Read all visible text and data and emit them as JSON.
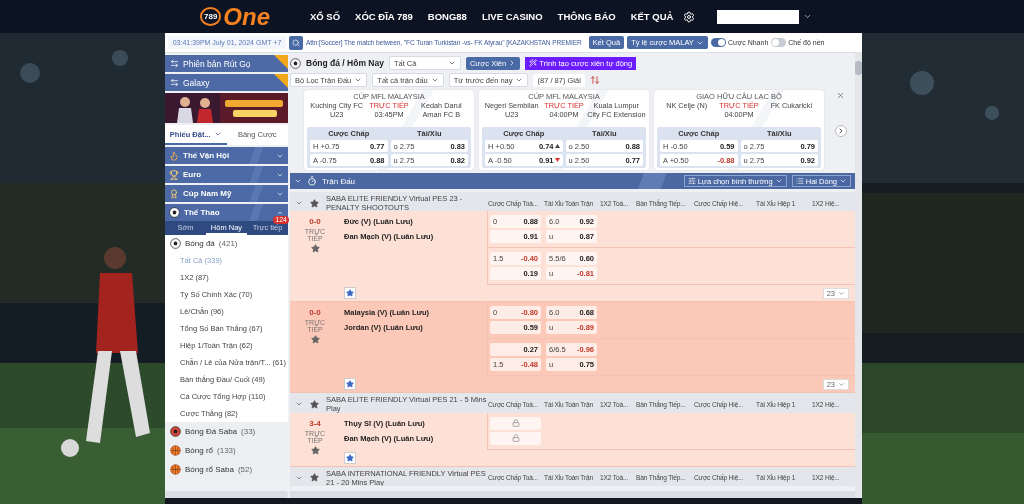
{
  "header": {
    "logo_number": "789",
    "logo_word": "One",
    "nav": [
      "XỔ SỐ",
      "XÓC ĐĨA 789",
      "BONG88",
      "LIVE CASINO",
      "THÔNG BÁO",
      "KẾT QUẢ"
    ]
  },
  "topbar": {
    "clock": "03:41:39PM July 01, 2024 GMT +7",
    "announcement": "Attn:[Soccer] The match between, \"FC Turan Turkistan -vs- FK Atyrau\" [KAZAKHSTAN PREMIER",
    "results_button": "Kết Quả",
    "odds_type": "Tỷ lệ cược MALAY",
    "toggles": [
      {
        "label": "Cược Nhanh",
        "on": true
      },
      {
        "label": "Chế độ nền",
        "on": false
      }
    ]
  },
  "sidebar": {
    "shortcuts": [
      {
        "label": "Phiên bản Rút Gọ",
        "new": true
      },
      {
        "label": "Galaxy",
        "new": true
      }
    ],
    "tabs": [
      {
        "label": "Phiếu Đặt...",
        "selected": true
      },
      {
        "label": "Bảng Cược",
        "selected": false
      }
    ],
    "sections": [
      {
        "label": "Thế Vận Hội",
        "kind": "torch",
        "expanded": false
      },
      {
        "label": "Euro",
        "kind": "trophy",
        "expanded": false
      },
      {
        "label": "Cúp Nam Mỹ",
        "kind": "cup",
        "expanded": false
      },
      {
        "label": "Thể Thao",
        "kind": "ball",
        "expanded": true
      }
    ],
    "period_tabs": [
      {
        "label": "Sớm",
        "selected": false
      },
      {
        "label": "Hôm Nay",
        "selected": true
      },
      {
        "label": "Trực tiếp",
        "selected": false,
        "badge": "124"
      }
    ],
    "sports": [
      {
        "name": "Bóng đá",
        "count": "(421)",
        "kind": "soccer",
        "expanded": true,
        "children": [
          {
            "name": "Tất Cả",
            "count": "(339)",
            "selected": true
          },
          {
            "name": "1X2",
            "count": "(87)",
            "selected": false
          },
          {
            "name": "Tỷ Số Chính Xác",
            "count": "(70)",
            "selected": false
          },
          {
            "name": "Lẻ/Chẵn",
            "count": "(96)",
            "selected": false
          },
          {
            "name": "Tổng Số Bàn Thắng",
            "count": "(67)",
            "selected": false
          },
          {
            "name": "Hiệp 1/Toàn Trận",
            "count": "(62)",
            "selected": false
          },
          {
            "name": "Chẵn / Lẻ của Nửa trận/T...",
            "count": "(61)",
            "selected": false
          },
          {
            "name": "Bàn thắng Đầu/ Cuối",
            "count": "(49)",
            "selected": false
          },
          {
            "name": "Cá Cược Tổng Hợp",
            "count": "(110)",
            "selected": false
          },
          {
            "name": "Cược Thắng",
            "count": "(82)",
            "selected": false
          }
        ]
      },
      {
        "name": "Bóng Đá Saba",
        "count": "(33)",
        "kind": "soccer-saba",
        "expanded": false
      },
      {
        "name": "Bóng rổ",
        "count": "(133)",
        "kind": "basketball",
        "expanded": false
      },
      {
        "name": "Bóng rổ Saba",
        "count": "(52)",
        "kind": "basketball-saba",
        "expanded": false
      }
    ]
  },
  "filters": {
    "title": "Bóng đá / Hôm Nay",
    "market_select": "Tất Cả",
    "parlay_button": "Cược Xiên",
    "parlay_builder": "Trình tạo cược xiên tự động",
    "dropdowns": [
      "Bộ Lọc Trận Đấu",
      "Tất cả trận đấu",
      "Từ trước đến nay"
    ],
    "league_count": "(87 / 87) Giải"
  },
  "featured": [
    {
      "league": "CÚP MFL MALAYSIA",
      "home": "Kuching City FC U23",
      "status": "TRỰC TIẾP",
      "time": "03:45PM",
      "away": "Kedah Darul Aman FC B",
      "handicap_label": "Cược Chấp",
      "total_label": "Tài/Xỉu",
      "handicap": [
        {
          "line": "H +0.75",
          "odds": "0.77",
          "negative": false,
          "up": false,
          "down": false
        },
        {
          "line": "A -0.75",
          "odds": "0.88",
          "negative": false,
          "up": false,
          "down": false
        }
      ],
      "total": [
        {
          "line": "o 2.75",
          "odds": "0.83",
          "negative": false,
          "up": false,
          "down": false
        },
        {
          "line": "u 2.75",
          "odds": "0.82",
          "negative": false,
          "up": false,
          "down": false
        }
      ]
    },
    {
      "league": "CÚP MFL MALAYSIA",
      "home": "Negeri Sembilan U23",
      "status": "TRỰC TIẾP",
      "time": "04:00PM",
      "away": "Kuala Lumpur City FC Extension",
      "handicap_label": "Cược Chấp",
      "total_label": "Tài/Xỉu",
      "handicap": [
        {
          "line": "H +0.50",
          "odds": "0.74",
          "negative": false,
          "up": true,
          "down": false
        },
        {
          "line": "A -0.50",
          "odds": "0.91",
          "negative": false,
          "up": false,
          "down": true
        }
      ],
      "total": [
        {
          "line": "o 2.50",
          "odds": "0.88",
          "negative": false,
          "up": false,
          "down": false
        },
        {
          "line": "u 2.50",
          "odds": "0.77",
          "negative": false,
          "up": false,
          "down": false
        }
      ]
    },
    {
      "league": "GIAO HỮU CÂU LẠC BỘ",
      "home": "NK Celje (N)",
      "status": "TRỰC TIẾP",
      "time": "04:00PM",
      "away": "FK Cukaricki",
      "handicap_label": "Cược Chấp",
      "total_label": "Tài/Xỉu",
      "handicap": [
        {
          "line": "H -0.50",
          "odds": "0.59",
          "negative": false,
          "up": false,
          "down": false
        },
        {
          "line": "A +0.50",
          "odds": "-0.88",
          "negative": true,
          "up": false,
          "down": false
        }
      ],
      "total": [
        {
          "line": "o 2.75",
          "odds": "0.79",
          "negative": false,
          "up": false,
          "down": false
        },
        {
          "line": "u 2.75",
          "odds": "0.92",
          "negative": false,
          "up": false,
          "down": false
        }
      ]
    }
  ],
  "matches_panel": {
    "title": "Trận Đấu",
    "view_select": "Lựa chọn bình thường",
    "layout_select": "Hai Dòng",
    "leagues": [
      {
        "name": "SABA ELITE FRIENDLY Virtual PES 23 - PENALTY SHOOTOUTS",
        "columns": [
          "Cược Chấp Toà...",
          "Tài Xỉu Toàn Trận",
          "1X2 Toà...",
          "Bàn Thắng Tiếp...",
          "Cược Chấp Hiệ...",
          "Tài Xỉu Hiệp 1",
          "1X2 Hiệ..."
        ],
        "matches": [
          {
            "score": "0-0",
            "status": "TRỰC TIẾP",
            "home": "Đức (V) (Luân Lưu)",
            "away": "Đan Mạch (V) (Luân Lưu)",
            "highlighted": false,
            "more": "23",
            "lines": [
              {
                "rows": [
                  {
                    "hdp": {
                      "line": "0",
                      "odds": "0.88",
                      "negative": false
                    },
                    "ou": {
                      "line": "6.0",
                      "odds": "0.92",
                      "negative": false
                    }
                  },
                  {
                    "hdp": {
                      "odds": "0.91",
                      "negative": false
                    },
                    "ou": {
                      "line": "u",
                      "odds": "0.87",
                      "negative": false
                    }
                  }
                ]
              },
              {
                "rows": [
                  {
                    "hdp": {
                      "line": "1.5",
                      "odds": "-0.40",
                      "negative": true
                    },
                    "ou": {
                      "line": "5.5/6",
                      "odds": "0.60",
                      "negative": false
                    }
                  },
                  {
                    "hdp": {
                      "odds": "0.19",
                      "negative": false
                    },
                    "ou": {
                      "line": "u",
                      "odds": "-0.81",
                      "negative": true
                    }
                  }
                ]
              }
            ]
          },
          {
            "score": "0-0",
            "status": "TRỰC TIẾP",
            "home": "Malaysia (V) (Luân Lưu)",
            "away": "Jordan (V) (Luân Lưu)",
            "highlighted": true,
            "more": "23",
            "lines": [
              {
                "rows": [
                  {
                    "hdp": {
                      "line": "0",
                      "odds": "-0.80",
                      "negative": true
                    },
                    "ou": {
                      "line": "6.0",
                      "odds": "0.68",
                      "negative": false
                    }
                  },
                  {
                    "hdp": {
                      "odds": "0.59",
                      "negative": false
                    },
                    "ou": {
                      "line": "u",
                      "odds": "-0.89",
                      "negative": true
                    }
                  }
                ]
              },
              {
                "rows": [
                  {
                    "hdp": {
                      "odds": "0.27",
                      "negative": false
                    },
                    "ou": {
                      "line": "6/6.5",
                      "odds": "-0.96",
                      "negative": true
                    }
                  },
                  {
                    "hdp": {
                      "line": "1.5",
                      "odds": "-0.48",
                      "negative": true
                    },
                    "ou": {
                      "line": "u",
                      "odds": "0.75",
                      "negative": false
                    }
                  }
                ]
              }
            ]
          }
        ]
      },
      {
        "name": "SABA ELITE FRIENDLY Virtual PES 21 - 5 Mins Play",
        "columns": [
          "Cược Chấp Toà...",
          "Tài Xỉu Toàn Trận",
          "1X2 Toà...",
          "Bàn Thắng Tiếp...",
          "Cược Chấp Hiệ...",
          "Tài Xỉu Hiệp 1",
          "1X2 Hiệ..."
        ],
        "matches": [
          {
            "score": "3-4",
            "status": "TRỰC TIẾP",
            "home": "Thụy Sĩ (V) (Luân Lưu)",
            "away": "Đan Mạch (V) (Luân Lưu)",
            "highlighted": false,
            "lines": [
              {
                "rows": [
                  {
                    "hdp": {
                      "locked": true
                    }
                  },
                  {
                    "hdp": {
                      "locked": true
                    }
                  }
                ]
              }
            ]
          }
        ]
      },
      {
        "name": "SABA INTERNATIONAL FRIENDLY Virtual PES 21 - 20 Mins Play",
        "columns": [
          "Cược Chấp Toà...",
          "Tài Xỉu Toàn Trận",
          "1X2 Toà...",
          "Bàn Thắng Tiếp...",
          "Cược Chấp Hiệ...",
          "Tài Xỉu Hiệp 1",
          "1X2 Hiệ..."
        ]
      }
    ]
  }
}
